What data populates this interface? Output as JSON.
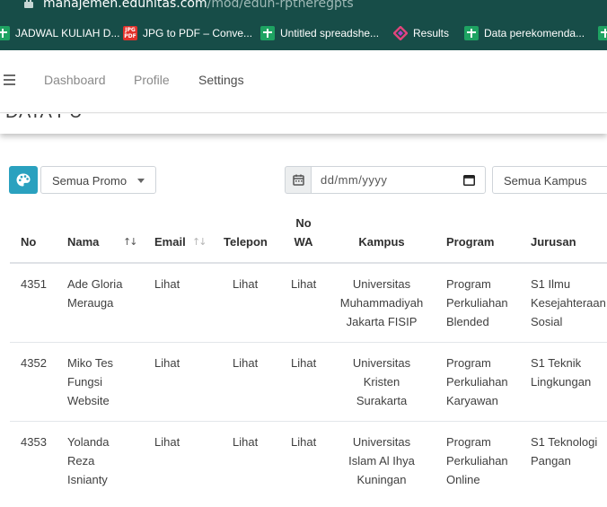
{
  "browser": {
    "url_host": "manajemen.edunitas.com",
    "url_path": "/mod/edun-rptheregpts",
    "bookmarks": [
      {
        "label": "JADWAL KULIAH D...",
        "icon": "sheets-icon"
      },
      {
        "label": "JPG to PDF – Conve...",
        "icon": "jpg-pdf-icon"
      },
      {
        "label": "Untitled spreadshe...",
        "icon": "sheets-icon"
      },
      {
        "label": "Results",
        "icon": "results-icon"
      },
      {
        "label": "Data perekomenda...",
        "icon": "sheets-icon"
      }
    ]
  },
  "nav": {
    "items": [
      "Dashboard",
      "Profile",
      "Settings"
    ]
  },
  "page": {
    "title": "DATA PU"
  },
  "filters": {
    "promo_select": "Semua Promo",
    "date_placeholder": "dd/mm/yyyy",
    "kampus_select": "Semua Kampus"
  },
  "table": {
    "headers": {
      "no": "No",
      "nama": "Nama",
      "email": "Email",
      "telepon": "Telepon",
      "no_wa_1": "No",
      "no_wa_2": "WA",
      "kampus": "Kampus",
      "program": "Program",
      "jurusan": "Jurusan"
    },
    "rows": [
      {
        "no": "4351",
        "nama": [
          "Ade Gloria",
          "Merauga"
        ],
        "email": "Lihat",
        "telepon": "Lihat",
        "wa": "Lihat",
        "kampus": [
          "Universitas",
          "Muhammadiyah",
          "Jakarta FISIP"
        ],
        "program": [
          "Program",
          "Perkuliahan",
          "Blended"
        ],
        "jurusan": [
          "S1 Ilmu",
          "Kesejahteraan",
          "Sosial"
        ]
      },
      {
        "no": "4352",
        "nama": [
          "Miko Tes",
          "Fungsi",
          "Website"
        ],
        "email": "Lihat",
        "telepon": "Lihat",
        "wa": "Lihat",
        "kampus": [
          "Universitas",
          "Kristen",
          "Surakarta"
        ],
        "program": [
          "Program",
          "Perkuliahan",
          "Karyawan"
        ],
        "jurusan": [
          "S1 Teknik",
          "Lingkungan"
        ]
      },
      {
        "no": "4353",
        "nama": [
          "Yolanda",
          "Reza",
          "Isnianty"
        ],
        "email": "Lihat",
        "telepon": "Lihat",
        "wa": "Lihat",
        "kampus": [
          "Universitas",
          "Islam Al Ihya",
          "Kuningan"
        ],
        "program": [
          "Program",
          "Perkuliahan",
          "Online"
        ],
        "jurusan": [
          "S1 Teknologi",
          "Pangan"
        ]
      }
    ]
  },
  "colors": {
    "browser_chrome": "#174d48",
    "palette_button": "#2aa1bf"
  }
}
